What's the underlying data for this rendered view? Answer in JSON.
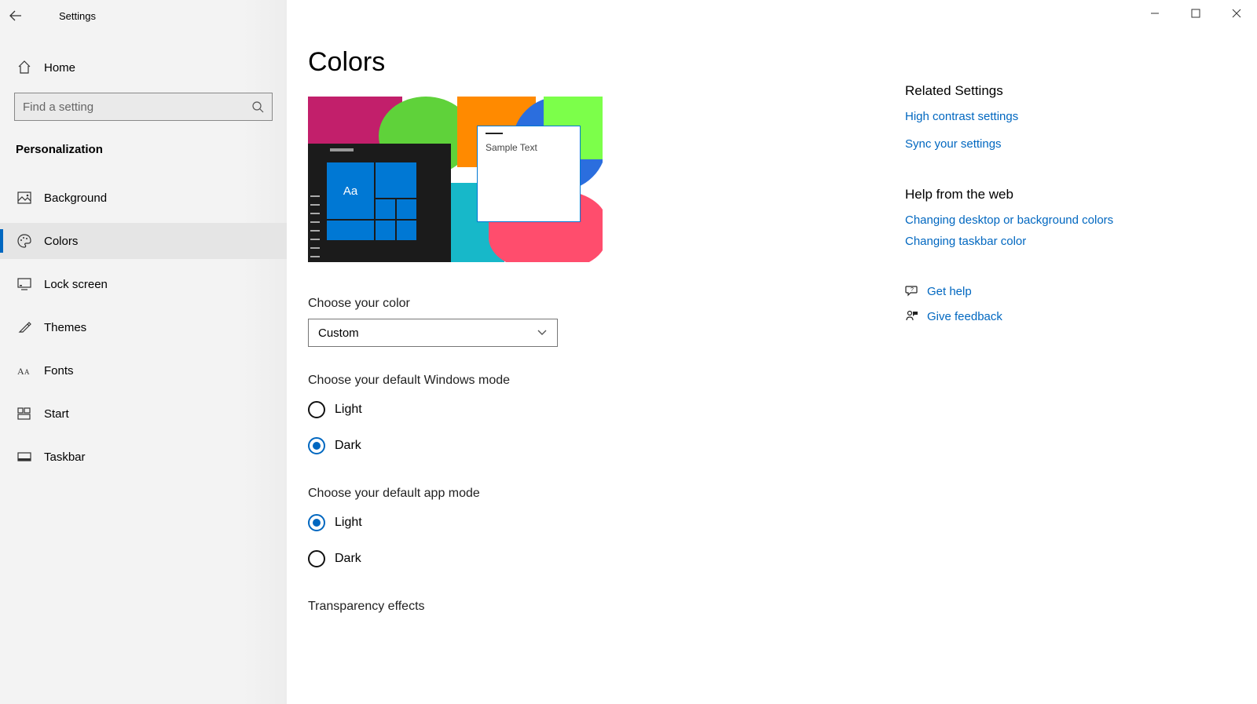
{
  "app": {
    "title": "Settings",
    "page_title": "Colors"
  },
  "sidebar": {
    "home": "Home",
    "search_placeholder": "Find a setting",
    "section": "Personalization",
    "items": [
      {
        "label": "Background"
      },
      {
        "label": "Colors"
      },
      {
        "label": "Lock screen"
      },
      {
        "label": "Themes"
      },
      {
        "label": "Fonts"
      },
      {
        "label": "Start"
      },
      {
        "label": "Taskbar"
      }
    ]
  },
  "preview": {
    "sample_text": "Sample Text",
    "start_aa": "Aa"
  },
  "color_mode": {
    "label": "Choose your color",
    "selected": "Custom"
  },
  "windows_mode": {
    "label": "Choose your default Windows mode",
    "options": [
      {
        "label": "Light",
        "selected": false
      },
      {
        "label": "Dark",
        "selected": true
      }
    ]
  },
  "app_mode": {
    "label": "Choose your default app mode",
    "options": [
      {
        "label": "Light",
        "selected": true
      },
      {
        "label": "Dark",
        "selected": false
      }
    ]
  },
  "transparency": {
    "label": "Transparency effects"
  },
  "related": {
    "title": "Related Settings",
    "links": [
      "High contrast settings",
      "Sync your settings"
    ]
  },
  "help": {
    "title": "Help from the web",
    "links": [
      "Changing desktop or background colors",
      "Changing taskbar color"
    ]
  },
  "actions": {
    "get_help": "Get help",
    "give_feedback": "Give feedback"
  }
}
